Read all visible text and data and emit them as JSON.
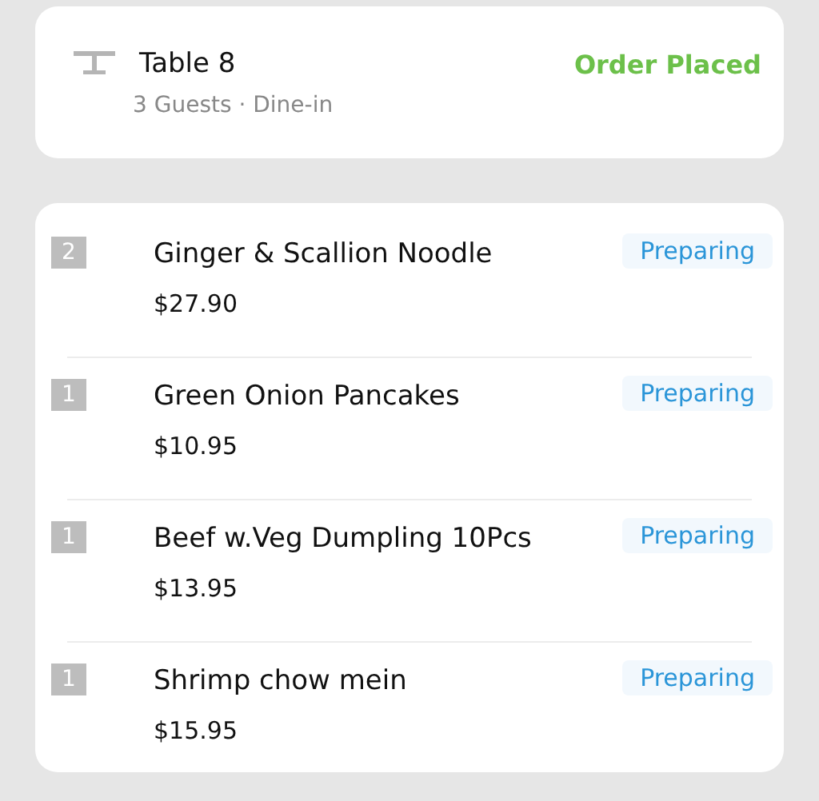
{
  "order": {
    "table": "Table 8",
    "details": "3 Guests · Dine-in",
    "status": "Order Placed"
  },
  "items": [
    {
      "quantity": "2",
      "name": "Ginger & Scallion Noodle",
      "price": "$27.90",
      "status": "Preparing"
    },
    {
      "quantity": "1",
      "name": "Green Onion Pancakes",
      "price": "$10.95",
      "status": "Preparing"
    },
    {
      "quantity": "1",
      "name": "Beef w.Veg Dumpling 10Pcs",
      "price": "$13.95",
      "status": "Preparing"
    },
    {
      "quantity": "1",
      "name": "Shrimp chow mein",
      "price": "$15.95",
      "status": "Preparing"
    }
  ]
}
